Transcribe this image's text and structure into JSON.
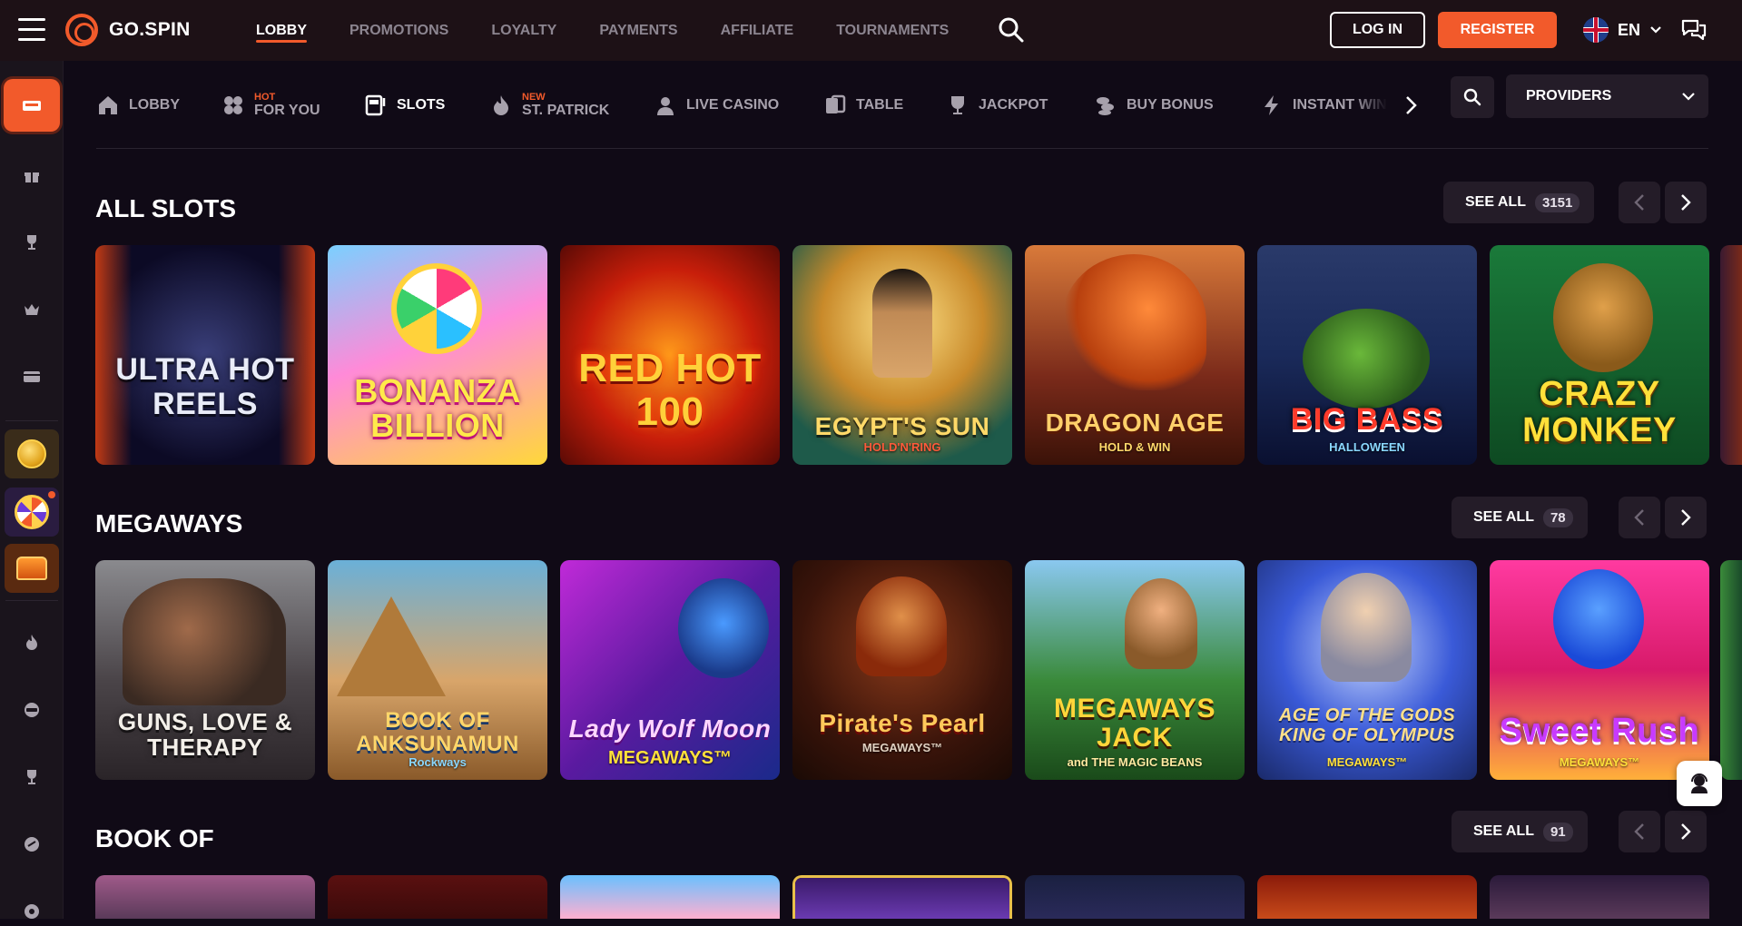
{
  "header": {
    "brand": "GO.SPIN",
    "nav": [
      {
        "label": "LOBBY",
        "active": true
      },
      {
        "label": "PROMOTIONS"
      },
      {
        "label": "LOYALTY"
      },
      {
        "label": "PAYMENTS"
      },
      {
        "label": "AFFILIATE"
      },
      {
        "label": "TOURNAMENTS"
      }
    ],
    "login_label": "LOG IN",
    "register_label": "REGISTER",
    "language": "EN",
    "accent": "#f25a2b"
  },
  "categories": [
    {
      "label": "LOBBY",
      "badge": "",
      "icon": "home-icon"
    },
    {
      "label": "FOR YOU",
      "badge": "HOT",
      "icon": "clover-icon"
    },
    {
      "label": "SLOTS",
      "badge": "",
      "icon": "slot-machine-icon",
      "active": true
    },
    {
      "label": "ST. PATRICK",
      "badge": "NEW",
      "icon": "flame-icon"
    },
    {
      "label": "LIVE CASINO",
      "badge": "",
      "icon": "dealer-icon"
    },
    {
      "label": "TABLE",
      "badge": "",
      "icon": "cards-icon"
    },
    {
      "label": "JACKPOT",
      "badge": "",
      "icon": "trophy-icon"
    },
    {
      "label": "BUY BONUS",
      "badge": "",
      "icon": "coins-icon"
    },
    {
      "label": "INSTANT WIN",
      "badge": "",
      "icon": "lightning-icon"
    }
  ],
  "providers_label": "PROVIDERS",
  "sections": [
    {
      "title": "ALL SLOTS",
      "see_all": "SEE ALL",
      "count": "3151",
      "games": [
        {
          "title": "ULTRA HOT REELS",
          "sub": ""
        },
        {
          "title": "BONANZA BILLION",
          "sub": ""
        },
        {
          "title": "RED HOT 100",
          "sub": ""
        },
        {
          "title": "EGYPT'S SUN",
          "sub": "HOLD'N'RING"
        },
        {
          "title": "DRAGON AGE",
          "sub": "HOLD & WIN"
        },
        {
          "title": "BIG BASS",
          "sub": "HALLOWEEN"
        },
        {
          "title": "CRAZY MONKEY",
          "sub": ""
        }
      ]
    },
    {
      "title": "MEGAWAYS",
      "see_all": "SEE ALL",
      "count": "78",
      "games": [
        {
          "title": "GUNS, LOVE & THERAPY",
          "sub": ""
        },
        {
          "title": "BOOK OF ANKSUNAMUN",
          "sub": "Rockways"
        },
        {
          "title": "Lady Wolf Moon",
          "sub": "MEGAWAYS™"
        },
        {
          "title": "Pirate's Pearl",
          "sub": "MEGAWAYS™"
        },
        {
          "title": "MEGAWAYS JACK",
          "sub": "and THE MAGIC BEANS"
        },
        {
          "title": "AGE OF THE GODS KING OF OLYMPUS",
          "sub": "MEGAWAYS™"
        },
        {
          "title": "Sweet Rush",
          "sub": "MEGAWAYS™"
        }
      ]
    },
    {
      "title": "BOOK OF",
      "see_all": "SEE ALL",
      "count": "91"
    }
  ]
}
